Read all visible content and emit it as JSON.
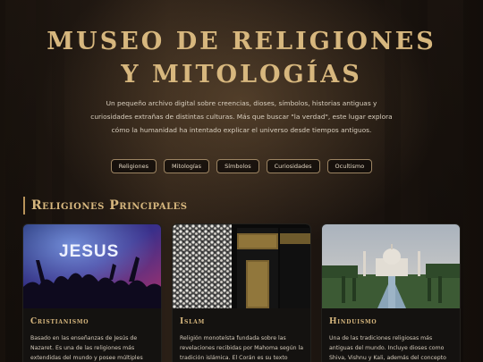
{
  "hero": {
    "title": "MUSEO DE RELIGIONES Y MITOLOGÍAS",
    "subtitle": "Un pequeño archivo digital sobre creencias, dioses, símbolos, historias antiguas y curiosidades extrañas de distintas culturas. Más que buscar \"la verdad\", este lugar explora cómo la humanidad ha intentado explicar el universo desde tiempos antiguos."
  },
  "nav": {
    "items": [
      {
        "label": "Religiones"
      },
      {
        "label": "Mitologías"
      },
      {
        "label": "Símbolos"
      },
      {
        "label": "Curiosidades"
      },
      {
        "label": "Ocultismo"
      }
    ]
  },
  "section": {
    "title": "Religiones Principales"
  },
  "cards": [
    {
      "title": "Cristianismo",
      "image_text": "JESUS",
      "text": "Basado en las enseñanzas de Jesús de Nazaret. Es una de las religiones más extendidas del mundo y posee múltiples ramas"
    },
    {
      "title": "Islam",
      "text": "Religión monoteísta fundada sobre las revelaciones recibidas por Mahoma según la tradición islámica. El Corán es su texto"
    },
    {
      "title": "Hinduismo",
      "text": "Una de las tradiciones religiosas más antiguas del mundo. Incluye dioses como Shiva, Vishnu y Kali, además del concepto de reencarnación y"
    }
  ],
  "colors": {
    "accent": "#d7b77e",
    "background": "#0d0a08",
    "card": "#141210",
    "border": "#9c8462"
  }
}
